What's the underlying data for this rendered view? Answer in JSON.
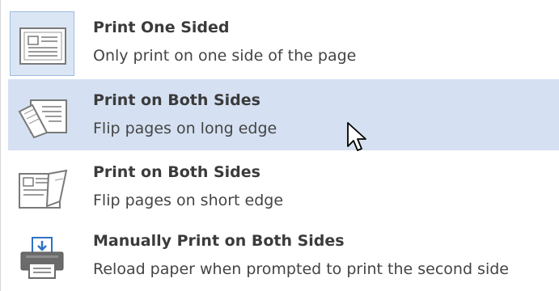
{
  "menu": {
    "options": [
      {
        "title": "Print One Sided",
        "description": "Only print on one side of the page",
        "icon": "page-one-sided-icon",
        "selected": true
      },
      {
        "title": "Print on Both Sides",
        "description": "Flip pages on long edge",
        "icon": "page-flip-long-edge-icon",
        "hovered": true
      },
      {
        "title": "Print on Both Sides",
        "description": "Flip pages on short edge",
        "icon": "page-flip-short-edge-icon"
      },
      {
        "title": "Manually Print on Both Sides",
        "description": "Reload paper when prompted to print the second side",
        "icon": "printer-icon"
      }
    ]
  },
  "colors": {
    "hover_background": "#d5e1f2",
    "selected_background": "#dbe6f4",
    "selected_border": "#9ebbe0",
    "printer_blue": "#2e73c2",
    "icon_gray": "#7a7a7a"
  }
}
